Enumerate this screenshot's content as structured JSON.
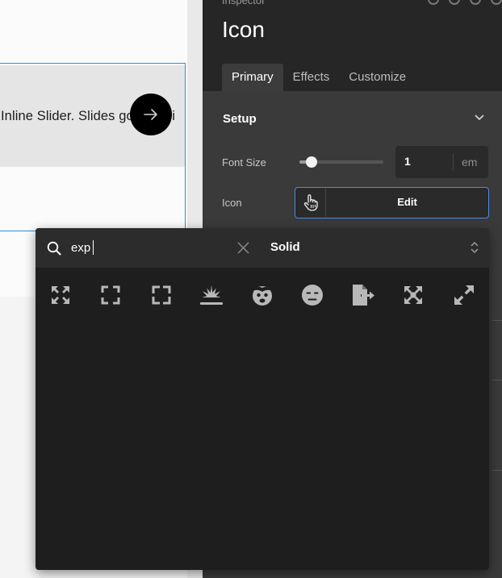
{
  "canvas": {
    "slide_text": "Inline Slider. Slides go over ri",
    "arrow_icon": "arrow-right-icon"
  },
  "inspector": {
    "panel_label": "Inspector",
    "title": "Icon",
    "tabs": [
      {
        "label": "Primary",
        "active": true
      },
      {
        "label": "Effects",
        "active": false
      },
      {
        "label": "Customize",
        "active": false
      }
    ],
    "section_title": "Setup",
    "font_size": {
      "label": "Font Size",
      "value": "1",
      "unit": "em",
      "slider_fraction": 0.14
    },
    "icon_field": {
      "label": "Icon",
      "preview_icon": "hand-pointer-icon",
      "edit_label": "Edit"
    },
    "accent_color": "#4a8ce8"
  },
  "picker": {
    "search_value": "exp",
    "style_value": "Solid",
    "results": [
      {
        "name": "expand-arrows-alt-icon"
      },
      {
        "name": "expand-icon"
      },
      {
        "name": "expand-icon"
      },
      {
        "name": "explosion-icon"
      },
      {
        "name": "face-explode-icon"
      },
      {
        "name": "face-expressionless-icon"
      },
      {
        "name": "file-export-icon"
      },
      {
        "name": "maximize-icon"
      },
      {
        "name": "up-right-and-down-left-icon"
      }
    ]
  }
}
